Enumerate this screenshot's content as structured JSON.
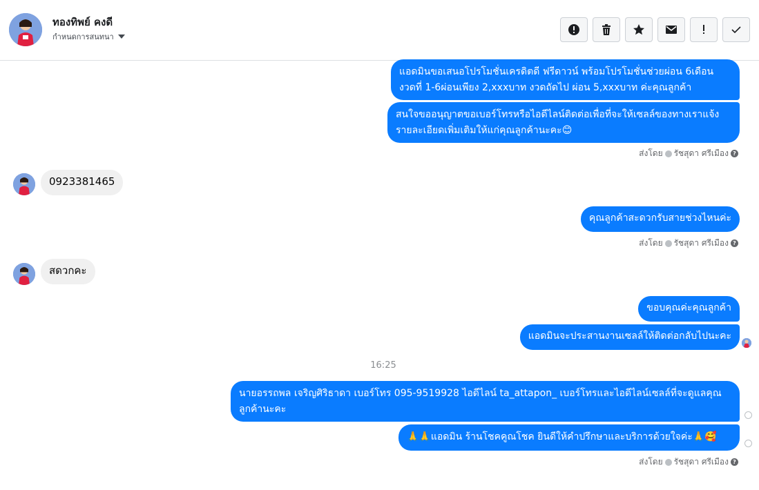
{
  "header": {
    "contact_name": "ทองทิพย์ คงดี",
    "subtitle": "กำหนดการสนทนา"
  },
  "toolbar": [
    {
      "icon": "alert-circle-icon",
      "label": "Report"
    },
    {
      "icon": "trash-icon",
      "label": "Delete"
    },
    {
      "icon": "star-icon",
      "label": "Star"
    },
    {
      "icon": "envelope-icon",
      "label": "Mark unread"
    },
    {
      "icon": "exclamation-icon",
      "label": "Spam"
    },
    {
      "icon": "check-icon",
      "label": "Done"
    }
  ],
  "messages": {
    "m1": "แอดมินขอเสนอโปรโมชั่นเครดิตดี ฟรีดาวน์ พร้อมโปรโมชั่นช่วยผ่อน 6เดือน งวดที่ 1-6ผ่อนเพียง 2,xxxบาท งวดถัดไป ผ่อน 5,xxxบาท ค่ะคุณลูกค้า",
    "m2": "สนใจขออนุญาตขอเบอร์โทรหรือไอดีไลน์ติดต่อเพื่อที่จะให้เซลล์ของทางเราแจ้งรายละเอียดเพิ่มเติมให้แก่คุณลูกค้านะคะ😊",
    "m3": "0923381465",
    "m4": "คุณลูกค้าสะดวกรับสายช่วงไหนค่ะ",
    "m5": "สดวกคะ",
    "m6": "ขอบคุณค่ะคุณลูกค้า",
    "m7": "แอดมินจะประสานงานเซลล์ให้ติดต่อกลับไปนะคะ",
    "m8": "นายอรรถพล เจริญศิริธาดา      เบอร์โทร 095-9519928 ไอดีไลน์ ta_attapon_  เบอร์โทรและไอดีไลน์เซลล์ที่จะดูแลคุณลูกค้านะคะ",
    "m9": "🙏🙏แอดมิน ร้านโชคคูณโชค ยินดีให้คำปรึกษาและบริการด้วยใจค่ะ🙏🥰"
  },
  "sent_by": {
    "prefix": "ส่งโดย",
    "agent": "รัชสุดา ศรีเมือง"
  },
  "timestamp": "16:25",
  "colors": {
    "outgoing": "#0a7cff",
    "incoming": "#f0f0f0"
  }
}
